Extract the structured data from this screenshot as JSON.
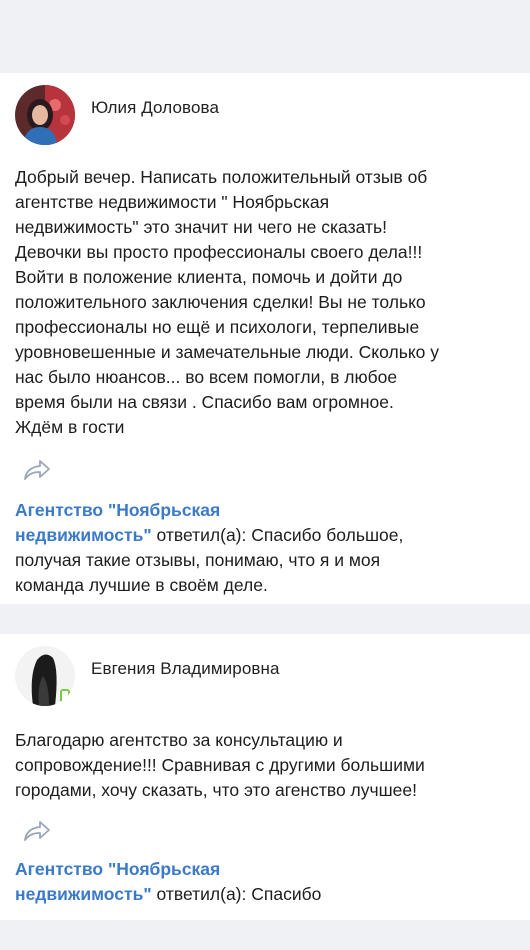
{
  "reviews": [
    {
      "author": "Юлия Доловова",
      "text": "Добрый вечер. Написать положительный отзыв об\nагентстве недвижимости \" Ноябрьская\nнедвижимость\" это значит ни чего не сказать!\nДевочки вы просто профессионалы своего дела!!!\nВойти в положение клиента, помочь и дойти до\nположительного заключения сделки! Вы не только\nпрофессионалы но ещё и психологи, терпеливые\nуровновешенные и замечательные люди. Сколько у\nнас было нюансов... во всем помогли, в любое\nвремя были на связи . Спасибо вам огромное.\nЖдём в гости",
      "reply": {
        "author_line1": "Агентство \"Ноябрьская",
        "author_line2": "недвижимость\"",
        "verb": "ответил(а):",
        "text": "Спасибо большое,\nполучая такие отзывы, понимаю, что я и моя\nкоманда лучшие в своём деле."
      }
    },
    {
      "author": "Евгения Владимировна",
      "text": "Благодарю агентство за консультацию и\nсопровождение!!! Сравнивая с другими большими\nгородами, хочу сказать, что это агенство лучшее!",
      "reply": {
        "author_line1": "Агентство \"Ноябрьская",
        "author_line2": "недвижимость\"",
        "verb": "ответил(а):",
        "text": "Спасибо"
      }
    }
  ],
  "colors": {
    "background": "#eff1f4",
    "card": "#ffffff",
    "link": "#3b7ac9",
    "icon": "#9aa6b8"
  },
  "icons": {
    "share": "share-icon"
  }
}
